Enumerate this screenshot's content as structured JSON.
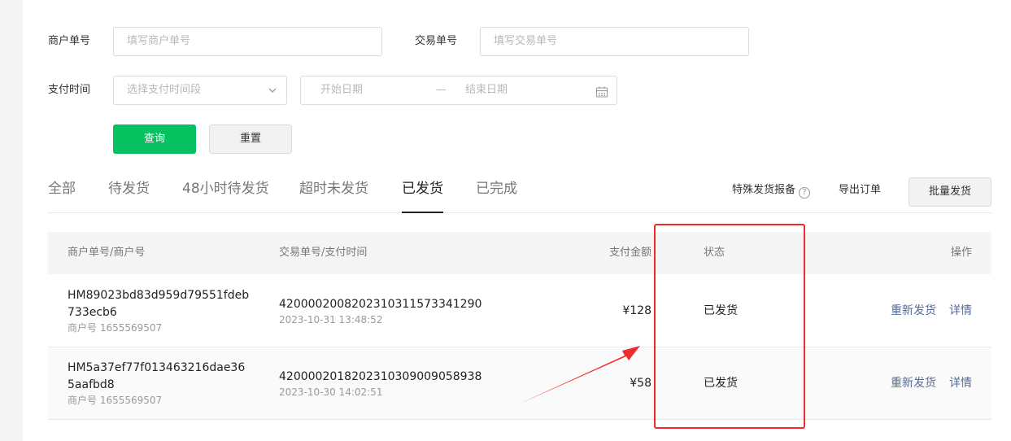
{
  "filters": {
    "merchant_order": {
      "label": "商户单号",
      "placeholder": "填写商户单号"
    },
    "trade_order": {
      "label": "交易单号",
      "placeholder": "填写交易单号"
    },
    "pay_time": {
      "label": "支付时间",
      "select_placeholder": "选择支付时间段",
      "start_placeholder": "开始日期",
      "separator": "—",
      "end_placeholder": "结束日期"
    },
    "query_label": "查询",
    "reset_label": "重置"
  },
  "tabs": [
    {
      "label": "全部",
      "active": false
    },
    {
      "label": "待发货",
      "active": false
    },
    {
      "label": "48小时待发货",
      "active": false
    },
    {
      "label": "超时未发货",
      "active": false
    },
    {
      "label": "已发货",
      "active": true
    },
    {
      "label": "已完成",
      "active": false
    }
  ],
  "actions": {
    "special_report": "特殊发货报备",
    "help_glyph": "?",
    "export": "导出订单",
    "batch_ship": "批量发货"
  },
  "table": {
    "headers": {
      "merchant": "商户单号/商户号",
      "trade": "交易单号/支付时间",
      "amount": "支付金额",
      "status": "状态",
      "ops": "操作"
    },
    "rows": [
      {
        "merchant_order": "HM89023bd83d959d79551fdeb733ecb6",
        "merchant_no": "商户号 1655569507",
        "trade_no": "4200002008202310311573341290",
        "pay_time": "2023-10-31 13:48:52",
        "amount": "¥128",
        "status": "已发货",
        "reship": "重新发货",
        "detail": "详情"
      },
      {
        "merchant_order": "HM5a37ef77f013463216dae365aafbd8",
        "merchant_no": "商户号 1655569507",
        "trade_no": "4200002018202310309009058938",
        "pay_time": "2023-10-30 14:02:51",
        "amount": "¥58",
        "status": "已发货",
        "reship": "重新发货",
        "detail": "详情"
      }
    ]
  },
  "colors": {
    "primary": "#07c160",
    "link": "#576b95",
    "annotation": "#f02b2b"
  }
}
